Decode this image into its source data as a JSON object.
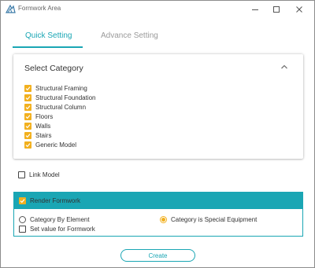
{
  "window": {
    "title": "Formwork Area"
  },
  "tabs": [
    {
      "label": "Quick Setting",
      "active": true
    },
    {
      "label": "Advance Setting",
      "active": false
    }
  ],
  "category_panel": {
    "title": "Select Category",
    "items": [
      {
        "label": "Structural Framing",
        "checked": true
      },
      {
        "label": "Structural Foundation",
        "checked": true
      },
      {
        "label": "Structural Column",
        "checked": true
      },
      {
        "label": "Floors",
        "checked": true
      },
      {
        "label": "Walls",
        "checked": true
      },
      {
        "label": "Stairs",
        "checked": true
      },
      {
        "label": "Generic Model",
        "checked": true
      }
    ]
  },
  "link_model": {
    "label": "Link Model",
    "checked": false
  },
  "render_panel": {
    "header_label": "Render Formwork",
    "header_checked": true,
    "options": {
      "by_element": {
        "label": "Category By Element",
        "selected": false
      },
      "special_equipment": {
        "label": "Category is Special Equipment",
        "selected": true
      },
      "set_value": {
        "label": "Set value for Formwork",
        "checked": false
      }
    }
  },
  "create_button": {
    "label": "Create"
  },
  "colors": {
    "accent": "#1aa6b4",
    "checkbox": "#f2b01e"
  }
}
